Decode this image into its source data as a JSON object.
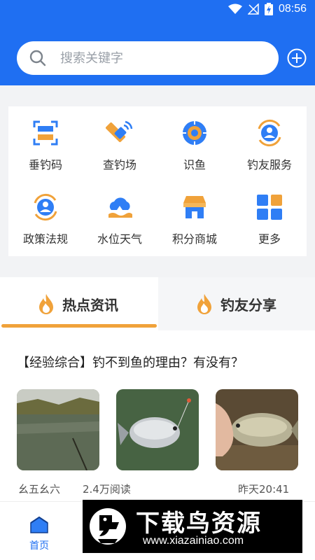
{
  "status_bar": {
    "time": "08:56"
  },
  "search": {
    "placeholder": "搜索关键字"
  },
  "grid": {
    "items": [
      {
        "label": "垂钓码",
        "icon": "scan-code-icon"
      },
      {
        "label": "查钓场",
        "icon": "satellite-icon"
      },
      {
        "label": "识鱼",
        "icon": "fish-recognize-icon"
      },
      {
        "label": "钓友服务",
        "icon": "user-service-icon"
      },
      {
        "label": "政策法规",
        "icon": "policy-icon"
      },
      {
        "label": "水位天气",
        "icon": "weather-icon"
      },
      {
        "label": "积分商城",
        "icon": "shop-icon"
      },
      {
        "label": "更多",
        "icon": "more-grid-icon"
      }
    ]
  },
  "tabs": [
    {
      "label": "热点资讯",
      "active": true
    },
    {
      "label": "钓友分享",
      "active": false
    }
  ],
  "article": {
    "title": "【经验综合】钓不到鱼的理由？有没有？",
    "author": "幺五幺六",
    "reads": "2.4万阅读",
    "time": "昨天20:41"
  },
  "bottom_nav": {
    "home_label": "首页"
  },
  "watermark": {
    "title": "下载鸟资源",
    "url": "www.xiazainiao.com"
  },
  "colors": {
    "primary": "#1f6ff2",
    "accent": "#f0a23a"
  }
}
